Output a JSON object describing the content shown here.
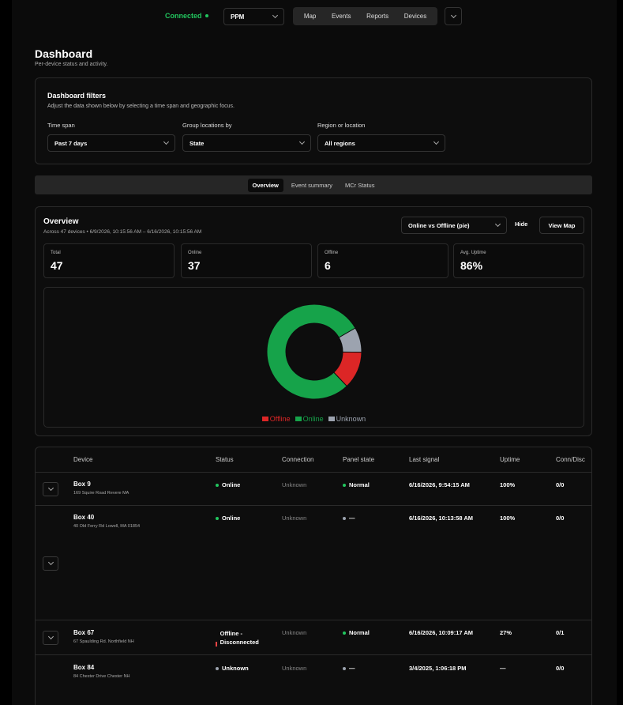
{
  "header": {
    "connection_status": "Connected",
    "site": "PPM",
    "nav": [
      "Map",
      "Events",
      "Reports",
      "Devices"
    ]
  },
  "page": {
    "title": "Dashboard",
    "subtitle": "Per-device status and activity."
  },
  "filters": {
    "title": "Dashboard filters",
    "description": "Adjust the data shown below by selecting a time span and geographic focus.",
    "time_span": {
      "label": "Time span",
      "value": "Past 7 days"
    },
    "group_by": {
      "label": "Group locations by",
      "value": "State"
    },
    "region": {
      "label": "Region or location",
      "value": "All regions"
    }
  },
  "tabs": [
    {
      "label": "Overview",
      "active": true
    },
    {
      "label": "Event summary",
      "active": false
    },
    {
      "label": "MCr Status",
      "active": false
    }
  ],
  "overview": {
    "title": "Overview",
    "subtitle": "Across 47 devices • 6/9/2026, 10:15:56 AM – 6/16/2026, 10:15:56 AM",
    "chart_select": "Online vs Offline (pie)",
    "hide_label": "Hide",
    "map_label": "View Map",
    "stats": [
      {
        "label": "Total",
        "value": "47"
      },
      {
        "label": "Online",
        "value": "37"
      },
      {
        "label": "Offline",
        "value": "6"
      },
      {
        "label": "Avg. Uptime",
        "value": "86%"
      }
    ]
  },
  "chart_data": {
    "type": "pie",
    "donut": true,
    "title": "",
    "legend_placement": "bottom",
    "series": [
      {
        "name": "Offline",
        "value": 6,
        "color": "#dc2626"
      },
      {
        "name": "Online",
        "value": 37,
        "color": "#16a34a"
      },
      {
        "name": "Unknown",
        "value": 4,
        "color": "#9ca3af"
      }
    ]
  },
  "table": {
    "columns": [
      "Device",
      "Status",
      "Connection",
      "Panel state",
      "Last signal",
      "Uptime",
      "Conn/Disc"
    ],
    "rows": [
      {
        "name": "Box 9",
        "address": "169 Squire Road Revere MA",
        "status": "Online",
        "status_color": "#22c55e",
        "connection": "Unknown",
        "panel": "Normal",
        "panel_color": "#22c55e",
        "last_signal": "6/16/2026, 9:54:15 AM",
        "uptime": "100%",
        "conn_disc": "0/0"
      },
      {
        "name": "Box 40",
        "address": "40 Old Ferry Rd Lowell, MA 01854",
        "status": "Online",
        "status_color": "#22c55e",
        "connection": "Unknown",
        "panel": "—",
        "panel_color": "#9ca3af",
        "last_signal": "6/16/2026, 10:13:58 AM",
        "uptime": "100%",
        "conn_disc": "0/0"
      },
      {
        "name": "Box 67",
        "address": "67 Spaulding Rd. Northfield NH",
        "status": "Offline - Disconnected",
        "status_color": "#ef4444",
        "connection": "Unknown",
        "panel": "Normal",
        "panel_color": "#22c55e",
        "last_signal": "6/16/2026, 10:09:17 AM",
        "uptime": "27%",
        "conn_disc": "0/1"
      },
      {
        "name": "Box 84",
        "address": "84 Chester Drive Chester NH",
        "status": "Unknown",
        "status_color": "#9ca3af",
        "connection": "Unknown",
        "panel": "—",
        "panel_color": "#9ca3af",
        "last_signal": "3/4/2025, 1:06:18 PM",
        "uptime": "—",
        "conn_disc": "0/0"
      }
    ]
  }
}
